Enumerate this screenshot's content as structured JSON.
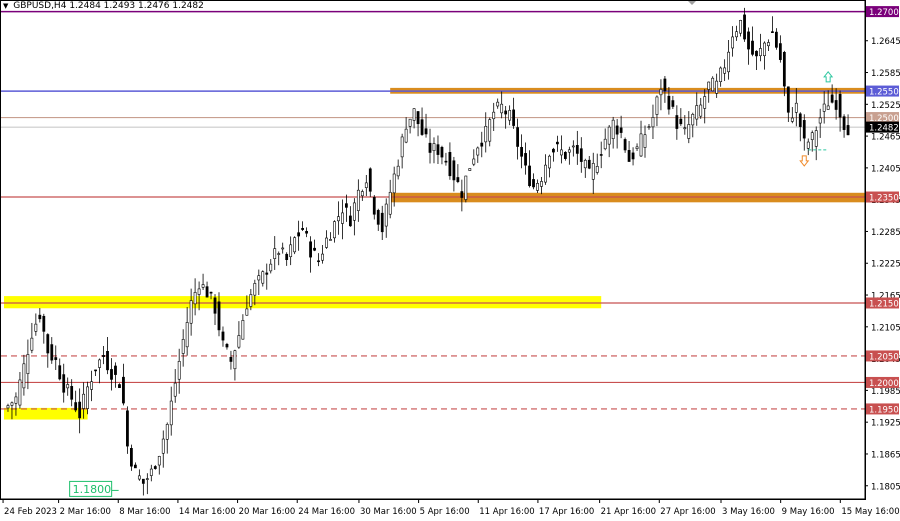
{
  "header": {
    "symbol_timeframe": "GBPUSD,H4",
    "ohlc": "1.2484 1.2493 1.2476 1.2482"
  },
  "colors": {
    "candle_up": "#000000",
    "candle_down": "#000000",
    "orange_zone": "#d98c1e",
    "yellow_zone": "#ffff00",
    "purple_line": "#7a007a",
    "blue_line": "#5c5cd6",
    "red_line": "#c85050",
    "tan_line": "#c8a090",
    "current_price_line": "#b0b0b0"
  },
  "chart_data": {
    "type": "candlestick",
    "symbol": "GBPUSD",
    "timeframe": "H4",
    "ylim": [
      1.178,
      1.272
    ],
    "y_ticks": [
      "1.2645",
      "1.2585",
      "1.2525",
      "1.2465",
      "1.2405",
      "1.2345",
      "1.2285",
      "1.2225",
      "1.2165",
      "1.2105",
      "1.2045",
      "1.1985",
      "1.1925",
      "1.1865",
      "1.1805"
    ],
    "x_ticks": [
      "24 Feb 2023",
      "2 Mar 16:00",
      "8 Mar 16:00",
      "14 Mar 16:00",
      "20 Mar 16:00",
      "24 Mar 16:00",
      "30 Mar 16:00",
      "5 Apr 16:00",
      "11 Apr 16:00",
      "17 Apr 16:00",
      "21 Apr 16:00",
      "27 Apr 16:00",
      "3 May 16:00",
      "9 May 16:00",
      "15 May 16:00"
    ],
    "close_path": [
      [
        0,
        1.195
      ],
      [
        3,
        1.197
      ],
      [
        5,
        1.203
      ],
      [
        7,
        1.2095
      ],
      [
        9,
        1.213
      ],
      [
        11,
        1.206
      ],
      [
        13,
        1.204
      ],
      [
        15,
        1.1995
      ],
      [
        17,
        1.197
      ],
      [
        19,
        1.194
      ],
      [
        21,
        1.199
      ],
      [
        23,
        1.203
      ],
      [
        25,
        1.205
      ],
      [
        27,
        1.202
      ],
      [
        29,
        1.2
      ],
      [
        30,
        1.196
      ],
      [
        31,
        1.188
      ],
      [
        33,
        1.183
      ],
      [
        35,
        1.181
      ],
      [
        37,
        1.183
      ],
      [
        39,
        1.187
      ],
      [
        41,
        1.192
      ],
      [
        43,
        1.2
      ],
      [
        45,
        1.208
      ],
      [
        47,
        1.215
      ],
      [
        49,
        1.219
      ],
      [
        51,
        1.217
      ],
      [
        53,
        1.214
      ],
      [
        55,
        1.207
      ],
      [
        57,
        1.204
      ],
      [
        59,
        1.209
      ],
      [
        61,
        1.215
      ],
      [
        63,
        1.218
      ],
      [
        65,
        1.22
      ],
      [
        67,
        1.223
      ],
      [
        69,
        1.225
      ],
      [
        71,
        1.223
      ],
      [
        73,
        1.227
      ],
      [
        75,
        1.229
      ],
      [
        77,
        1.225
      ],
      [
        79,
        1.223
      ],
      [
        81,
        1.227
      ],
      [
        83,
        1.23
      ],
      [
        85,
        1.233
      ],
      [
        87,
        1.231
      ],
      [
        89,
        1.236
      ],
      [
        91,
        1.239
      ],
      [
        93,
        1.233
      ],
      [
        95,
        1.229
      ],
      [
        97,
        1.236
      ],
      [
        99,
        1.242
      ],
      [
        101,
        1.249
      ],
      [
        103,
        1.251
      ],
      [
        105,
        1.247
      ],
      [
        107,
        1.244
      ],
      [
        109,
        1.244
      ],
      [
        111,
        1.242
      ],
      [
        113,
        1.239
      ],
      [
        115,
        1.236
      ],
      [
        117,
        1.241
      ],
      [
        119,
        1.245
      ],
      [
        121,
        1.247
      ],
      [
        123,
        1.251
      ],
      [
        125,
        1.252
      ],
      [
        127,
        1.25
      ],
      [
        129,
        1.245
      ],
      [
        131,
        1.24
      ],
      [
        133,
        1.237
      ],
      [
        135,
        1.239
      ],
      [
        137,
        1.244
      ],
      [
        139,
        1.244
      ],
      [
        141,
        1.243
      ],
      [
        143,
        1.244
      ],
      [
        145,
        1.242
      ],
      [
        147,
        1.239
      ],
      [
        149,
        1.242
      ],
      [
        151,
        1.246
      ],
      [
        153,
        1.249
      ],
      [
        155,
        1.247
      ],
      [
        157,
        1.242
      ],
      [
        159,
        1.244
      ],
      [
        161,
        1.247
      ],
      [
        163,
        1.25
      ],
      [
        165,
        1.256
      ],
      [
        167,
        1.253
      ],
      [
        169,
        1.249
      ],
      [
        171,
        1.247
      ],
      [
        173,
        1.25
      ],
      [
        175,
        1.252
      ],
      [
        177,
        1.256
      ],
      [
        179,
        1.256
      ],
      [
        181,
        1.26
      ],
      [
        183,
        1.266
      ],
      [
        185,
        1.268
      ],
      [
        187,
        1.263
      ],
      [
        189,
        1.261
      ],
      [
        191,
        1.264
      ],
      [
        193,
        1.266
      ],
      [
        195,
        1.261
      ],
      [
        197,
        1.25
      ],
      [
        199,
        1.252
      ],
      [
        201,
        1.245
      ],
      [
        203,
        1.246
      ],
      [
        205,
        1.25
      ],
      [
        207,
        1.253
      ],
      [
        209,
        1.253
      ],
      [
        211,
        1.249
      ],
      [
        212,
        1.2482
      ]
    ],
    "levels": [
      {
        "price": 1.27,
        "label": "1.2700",
        "style": "solid",
        "color": "#7a007a"
      },
      {
        "price": 1.255,
        "label": "1.2550",
        "style": "solid",
        "color": "#5c5cd6"
      },
      {
        "price": 1.25,
        "label": "1.2500",
        "style": "solid",
        "color": "#c8a090"
      },
      {
        "price": 1.2482,
        "label": "1.2482",
        "style": "current",
        "color": "#000000"
      },
      {
        "price": 1.235,
        "label": "1.2350",
        "style": "solid",
        "color": "#c85050"
      },
      {
        "price": 1.215,
        "label": "1.2150",
        "style": "solid",
        "color": "#c85050"
      },
      {
        "price": 1.205,
        "label": "1.2050",
        "style": "dashed",
        "color": "#c85050"
      },
      {
        "price": 1.2,
        "label": "1.2000",
        "style": "solid",
        "color": "#c85050"
      },
      {
        "price": 1.195,
        "label": "1.1950",
        "style": "dashed",
        "color": "#c85050"
      }
    ],
    "zones": [
      {
        "from": 1.2545,
        "to": 1.2556,
        "start_index": 97,
        "color": "#d98c1e"
      },
      {
        "from": 1.234,
        "to": 1.2358,
        "start_index": 97,
        "color": "#d98c1e"
      },
      {
        "from": 1.214,
        "to": 1.2163,
        "start_index": 0,
        "end_index": 150,
        "color": "#ffff00"
      },
      {
        "from": 1.193,
        "to": 1.1952,
        "start_index": 0,
        "end_index": 21,
        "color": "#ffff00"
      }
    ],
    "annotations": [
      {
        "text": "1.1800",
        "price": 1.18,
        "index": 19,
        "color": "#1cbf6a"
      }
    ],
    "signals": [
      {
        "type": "up-arrow",
        "price": 1.2575,
        "index": 207,
        "color": "#2ec7a0"
      },
      {
        "type": "down-arrow",
        "price": 1.242,
        "index": 201,
        "color": "#f08a2a"
      }
    ]
  }
}
